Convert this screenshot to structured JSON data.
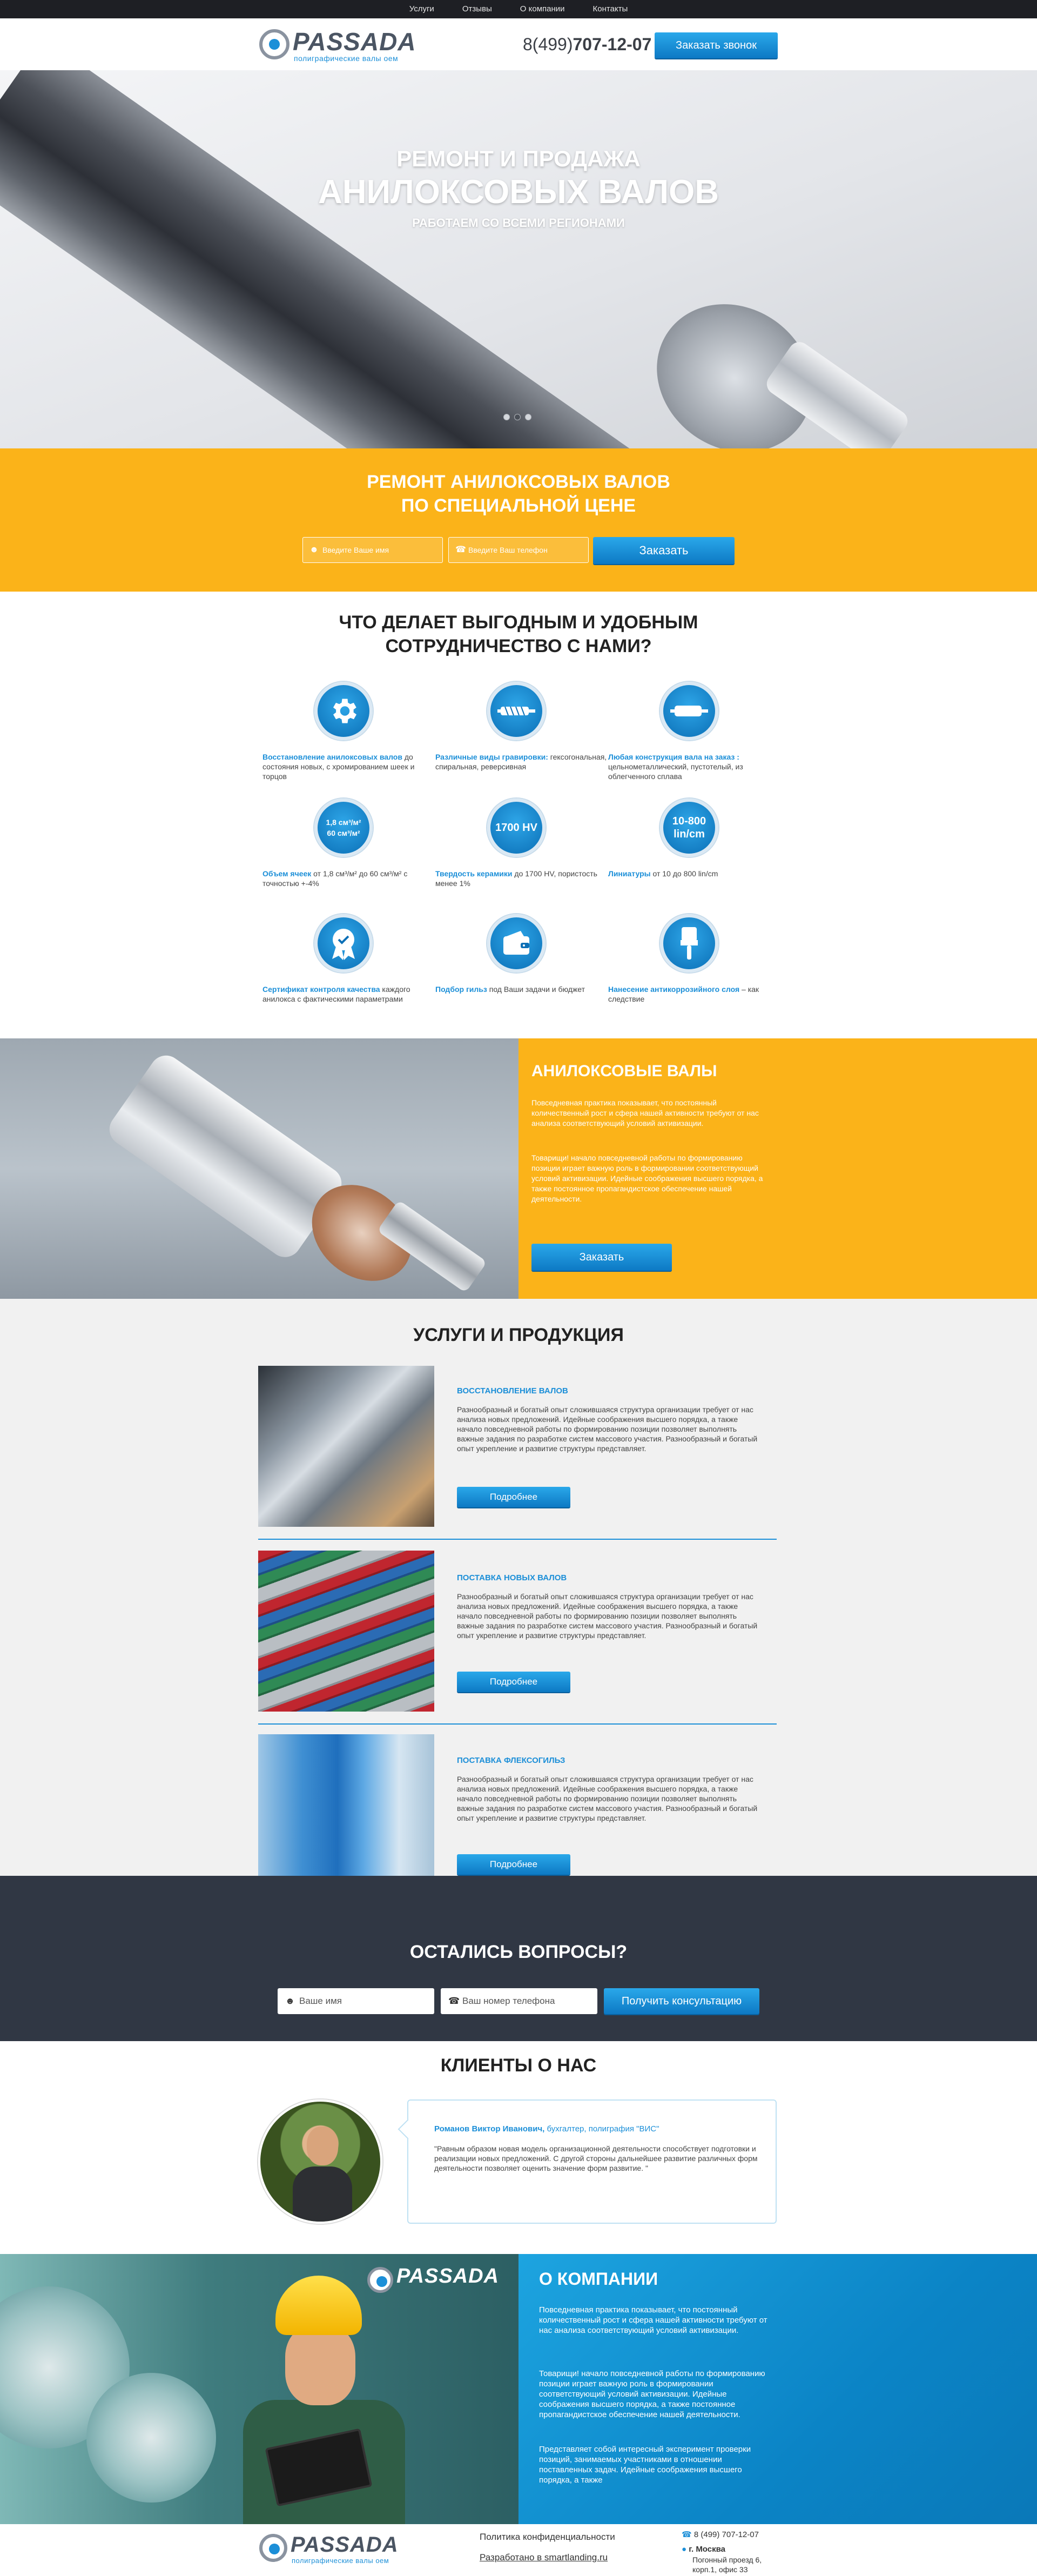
{
  "nav": {
    "items": [
      "Услуги",
      "Отзывы",
      "О компании",
      "Контакты"
    ]
  },
  "header": {
    "logo_text": "PASSADA",
    "logo_sub": "полиграфические валы оем",
    "phone_prefix": "8(499)",
    "phone_main": "707-12-07",
    "call_button": "Заказать звонок"
  },
  "hero": {
    "line1": "РЕМОНТ И ПРОДАЖА",
    "line2": "АНИЛОКСОВЫХ ВАЛОВ",
    "line3": "РАБОТАЕМ СО ВСЕМИ РЕГИОНАМИ",
    "slides": 3,
    "active_slide": 2
  },
  "promo": {
    "title1": "РЕМОНТ АНИЛОКСОВЫХ ВАЛОВ",
    "title2": "ПО СПЕЦИАЛЬНОЙ ЦЕНЕ",
    "name_placeholder": "Введите Ваше имя",
    "phone_placeholder": "Введите Ваш телефон",
    "button": "Заказать"
  },
  "benefits": {
    "title1": "ЧТО ДЕЛАЕТ ВЫГОДНЫМ И УДОБНЫМ",
    "title2": "СОТРУДНИЧЕСТВО С НАМИ?",
    "items": [
      {
        "icon": "gear-icon",
        "bold": "Восстановление анилоксовых валов",
        "text": " до состояния новых, с хромированием шеек и торцов"
      },
      {
        "icon": "engraving-roll-icon",
        "bold": "Различные виды гравировки:",
        "text": " гексогональная, спиральная, реверсивная"
      },
      {
        "icon": "roll-icon",
        "bold": "Любая конструкция вала на заказ :",
        "text": " цельнометаллический, пустотелый, из облегченного сплава"
      },
      {
        "icon_text": "1,8 см³/м²",
        "icon_text2": "60 см³/м²",
        "bold": "Объем ячеек",
        "text": " от 1,8 см³/м² до 60 см³/м² с точностью +-4%"
      },
      {
        "icon_text": "1700 HV",
        "bold": "Твердость керамики",
        "text": " до 1700 HV, пористость менее 1%"
      },
      {
        "icon_text": "10-800",
        "icon_text2": "lin/cm",
        "bold": "Линиатуры",
        "text": " от 10 до 800 lin/cm"
      },
      {
        "icon": "certificate-icon",
        "bold": "Сертификат контроля качества",
        "text": " каждого анилокса с фактическими параметрами"
      },
      {
        "icon": "wallet-icon",
        "bold": "Подбор гильз",
        "text": " под Ваши задачи и бюджет"
      },
      {
        "icon": "brush-icon",
        "bold": "Нанесение антикоррозийного слоя",
        "text": " – как следствие"
      }
    ]
  },
  "anilox": {
    "title": "АНИЛОКСОВЫЕ ВАЛЫ",
    "p1": "Повседневная практика показывает, что постоянный количественный рост и сфера нашей активности требуют от нас анализа соответствующий условий активизации.",
    "p2": "Товарищи! начало повседневной работы по формированию позиции играет важную роль в формировании соответствующий условий активизации. Идейные соображения высшего порядка, а также постоянное пропагандистское обеспечение нашей деятельности.",
    "button": "Заказать"
  },
  "services": {
    "title": "УСЛУГИ И ПРОДУКЦИЯ",
    "text": "Разнообразный и богатый опыт сложившаяся структура организации требует от нас анализа новых предложений. Идейные соображения высшего порядка, а также начало повседневной работы по формированию позиции позволяет выполнять важные задания по разработке систем массового участия. Разнообразный и богатый опыт укрепление и развитие структуры представляет.",
    "button": "Подробнее",
    "items": [
      {
        "title": "ВОССТАНОВЛЕНИЕ ВАЛОВ"
      },
      {
        "title": "ПОСТАВКА НОВЫХ ВАЛОВ"
      },
      {
        "title": "ПОСТАВКА ФЛЕКСОГИЛЬЗ"
      }
    ]
  },
  "questions": {
    "title": "ОСТАЛИСЬ ВОПРОСЫ?",
    "name_placeholder": "Ваше имя",
    "phone_placeholder": "Ваш номер телефона",
    "button": "Получить консультацию"
  },
  "clients": {
    "title": "КЛИЕНТЫ О НАС",
    "name": "Романов Виктор Иванович,",
    "role": " бухгалтер, полиграфия \"ВИС\"",
    "quote": "\"Равным образом новая модель организационной деятельности способствует подготовки и реализации новых предложений. С другой стороны дальнейшее развитие различных форм деятельности позволяет оценить значение форм развитие. \""
  },
  "about": {
    "title": "О КОМПАНИИ",
    "p1": "Повседневная практика показывает, что постоянный количественный рост и сфера нашей активности требуют от нас анализа соответствующий условий активизации.",
    "p2": "Товарищи! начало повседневной работы по формированию позиции играет важную роль в формировании соответствующий условий активизации. Идейные соображения высшего порядка, а также постоянное пропагандистское обеспечение нашей деятельности.",
    "p3": "Представляет собой интересный эксперимент проверки позиций, занимаемых участниками в отношении поставленных задач. Идейные соображения высшего порядка, а также"
  },
  "footer": {
    "privacy": "Политика конфиденциальности",
    "developed": "Разработано в smartlanding.ru",
    "phone": "8 (499) 707-12-07",
    "city": "г. Москва",
    "address1": "Погонный проезд 6,",
    "address2": "корп.1, офис 33"
  },
  "colors": {
    "accent": "#1c8fd8",
    "yellow": "#fbb319",
    "dark": "#303744"
  }
}
